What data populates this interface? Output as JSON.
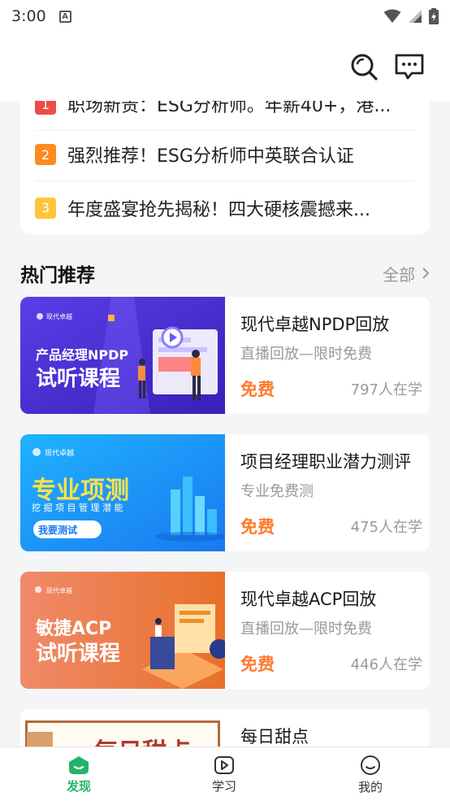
{
  "status_bar": {
    "time": "3:00",
    "notification_icon": "A"
  },
  "header": {
    "search_icon": "search-icon",
    "message_icon": "message-icon"
  },
  "news": [
    {
      "rank": "1",
      "text": "职场新贵：ESG分析师。年薪40+，港...",
      "color": "#f04b47"
    },
    {
      "rank": "2",
      "text": "强烈推荐！ESG分析师中英联合认证",
      "color": "#ff8a1f"
    },
    {
      "rank": "3",
      "text": "年度盛宴抢先揭秘！四大硬核震撼来...",
      "color": "#ffc53a"
    }
  ],
  "section": {
    "title": "热门推荐",
    "more": "全部"
  },
  "courses": [
    {
      "title": "现代卓越NPDP回放",
      "subtitle": "直播回放—限时免费",
      "price": "免费",
      "learners": "797人在学",
      "banner": {
        "brand": "现代卓越",
        "line1": "产品经理NPDP",
        "line2": "试听课程"
      }
    },
    {
      "title": "项目经理职业潜力测评",
      "subtitle": "专业免费测",
      "price": "免费",
      "learners": "475人在学",
      "banner": {
        "brand": "现代卓越",
        "line1": "专业项测",
        "line2": "挖 掘 项 目 管 理 潜 能",
        "button": "我要测试"
      }
    },
    {
      "title": "现代卓越ACP回放",
      "subtitle": "直播回放—限时免费",
      "price": "免费",
      "learners": "446人在学",
      "banner": {
        "brand": "现代卓越",
        "line1": "敏捷ACP",
        "line2": "试听课程"
      }
    },
    {
      "title": "每日甜点",
      "subtitle": "",
      "price": "",
      "learners": "",
      "banner": {
        "line1": "每日甜点"
      }
    }
  ],
  "tabs": [
    {
      "label": "发现",
      "icon": "discover-icon",
      "active": true
    },
    {
      "label": "学习",
      "icon": "play-icon",
      "active": false
    },
    {
      "label": "我的",
      "icon": "smile-icon",
      "active": false
    }
  ],
  "colors": {
    "accent": "#22b46a",
    "price": "#ff7a2e"
  }
}
